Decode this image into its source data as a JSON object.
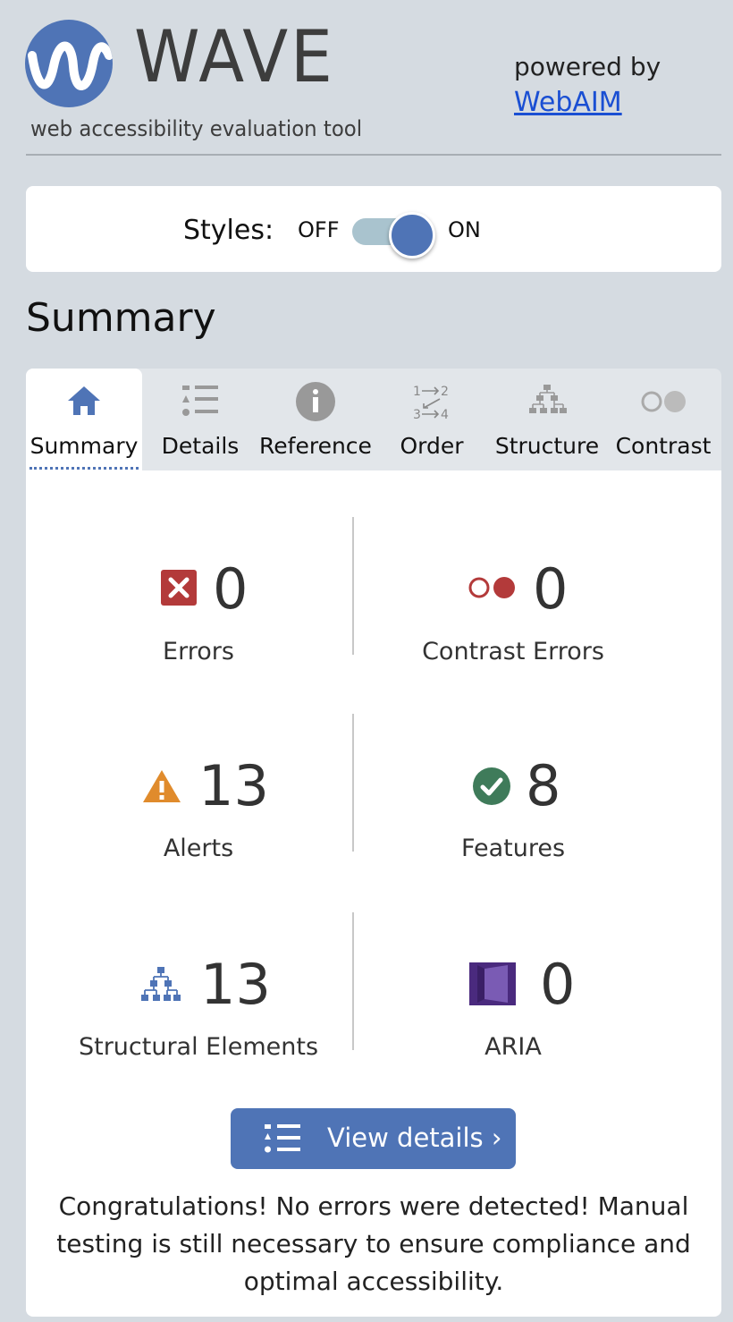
{
  "header": {
    "app_name": "WAVE",
    "tagline": "web accessibility evaluation tool",
    "powered_by": "powered by",
    "webaim_link": "WebAIM",
    "logo_icon": "wave-logo-icon"
  },
  "styles_toggle": {
    "label": "Styles:",
    "off": "OFF",
    "on": "ON",
    "state": "on"
  },
  "section_title": "Summary",
  "tabs": [
    {
      "label": "Summary",
      "icon": "home-icon",
      "active": true
    },
    {
      "label": "Details",
      "icon": "list-icon",
      "active": false
    },
    {
      "label": "Reference",
      "icon": "info-icon",
      "active": false
    },
    {
      "label": "Order",
      "icon": "order-icon",
      "active": false
    },
    {
      "label": "Structure",
      "icon": "structure-icon",
      "active": false
    },
    {
      "label": "Contrast",
      "icon": "contrast-icon",
      "active": false
    }
  ],
  "stats": {
    "errors": {
      "count": "0",
      "label": "Errors",
      "color": "#b33a3a"
    },
    "contrast_errors": {
      "count": "0",
      "label": "Contrast Errors",
      "color": "#b33a3a"
    },
    "alerts": {
      "count": "13",
      "label": "Alerts",
      "color": "#e08b2c"
    },
    "features": {
      "count": "8",
      "label": "Features",
      "color": "#3f7b5a"
    },
    "structural": {
      "count": "13",
      "label": "Structural Elements",
      "color": "#4f74b6"
    },
    "aria": {
      "count": "0",
      "label": "ARIA",
      "color": "#4a2a7e"
    }
  },
  "view_details": "View details ›",
  "message": "Congratulations! No errors were detected! Manual testing is still necessary to ensure compliance and optimal accessibility.",
  "colors": {
    "accent": "#4f74b6",
    "background": "#d5dbe1",
    "toggle_track": "#a9c3ce"
  }
}
